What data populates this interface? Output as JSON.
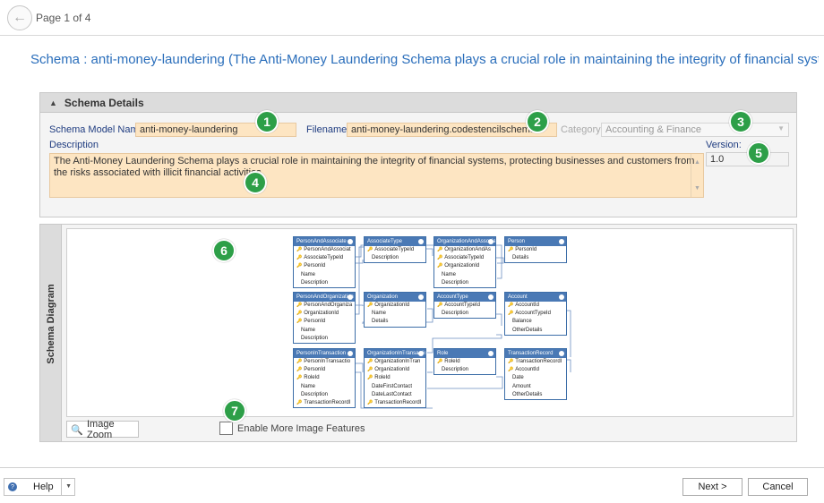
{
  "header": {
    "back_icon": "back-arrow-icon",
    "page_indicator": "Page 1 of 4"
  },
  "schema_title": "Schema : anti-money-laundering (The Anti-Money Laundering Schema plays a crucial role in maintaining the integrity of financial systen",
  "details": {
    "header": "Schema Details",
    "schema_model_name_label": "Schema Model Name:",
    "schema_model_name_value": "anti-money-laundering",
    "filename_label": "Filename:",
    "filename_value": "anti-money-laundering.codestencilschema",
    "category_label": "Category:",
    "category_value": "Accounting & Finance",
    "description_label": "Description",
    "description_value": "The Anti-Money Laundering Schema plays a crucial role in maintaining the integrity of financial systems, protecting businesses and customers from the risks associated with illicit financial activities.",
    "version_label": "Version:",
    "version_value": "1.0"
  },
  "badges": [
    "1",
    "2",
    "3",
    "4",
    "5",
    "6",
    "7"
  ],
  "diagram": {
    "side_label": "Schema Diagram",
    "tables": [
      {
        "name": "PersonAndAssociate",
        "rows": [
          {
            "t": "PersonAndAssociat",
            "k": true
          },
          {
            "t": "AssociateTypeId",
            "k": true
          },
          {
            "t": "PersonId",
            "k": true
          },
          {
            "t": "Name",
            "k": false
          },
          {
            "t": "Description",
            "k": false
          }
        ]
      },
      {
        "name": "AssociateType",
        "rows": [
          {
            "t": "AssociateTypeId",
            "k": true
          },
          {
            "t": "Description",
            "k": false
          }
        ]
      },
      {
        "name": "OrganizationAndAssociate",
        "rows": [
          {
            "t": "OrganizationAndAs",
            "k": true
          },
          {
            "t": "AssociateTypeId",
            "k": true
          },
          {
            "t": "OrganizationId",
            "k": true
          },
          {
            "t": "Name",
            "k": false
          },
          {
            "t": "Description",
            "k": false
          }
        ]
      },
      {
        "name": "Person",
        "rows": [
          {
            "t": "PersonId",
            "k": true
          },
          {
            "t": "Details",
            "k": false
          }
        ]
      },
      {
        "name": "PersonAndOrganization",
        "rows": [
          {
            "t": "PersonAndOrganiza",
            "k": true
          },
          {
            "t": "OrganizationId",
            "k": true
          },
          {
            "t": "PersonId",
            "k": true
          },
          {
            "t": "Name",
            "k": false
          },
          {
            "t": "Description",
            "k": false
          }
        ]
      },
      {
        "name": "Organization",
        "rows": [
          {
            "t": "OrganizationId",
            "k": true
          },
          {
            "t": "Name",
            "k": false
          },
          {
            "t": "Details",
            "k": false
          }
        ]
      },
      {
        "name": "AccountType",
        "rows": [
          {
            "t": "AccountTypeId",
            "k": true
          },
          {
            "t": "Description",
            "k": false
          }
        ]
      },
      {
        "name": "Account",
        "rows": [
          {
            "t": "AccountId",
            "k": true
          },
          {
            "t": "AccountTypeId",
            "k": true
          },
          {
            "t": "Balance",
            "k": false
          },
          {
            "t": "OtherDetails",
            "k": false
          }
        ]
      },
      {
        "name": "PersonInTransaction",
        "rows": [
          {
            "t": "PersonInTransactio",
            "k": true
          },
          {
            "t": "PersonId",
            "k": true
          },
          {
            "t": "RoleId",
            "k": true
          },
          {
            "t": "Name",
            "k": false
          },
          {
            "t": "Description",
            "k": false
          },
          {
            "t": "TransactionRecordI",
            "k": true
          }
        ]
      },
      {
        "name": "OrganizationInTransaction",
        "rows": [
          {
            "t": "OrganizationInTran",
            "k": true
          },
          {
            "t": "OrganizationId",
            "k": true
          },
          {
            "t": "RoleId",
            "k": true
          },
          {
            "t": "DateFirstContact",
            "k": false
          },
          {
            "t": "DateLastContact",
            "k": false
          },
          {
            "t": "TransactionRecordI",
            "k": true
          }
        ]
      },
      {
        "name": "Role",
        "rows": [
          {
            "t": "RoleId",
            "k": true
          },
          {
            "t": "Description",
            "k": false
          }
        ]
      },
      {
        "name": "TransactionRecord",
        "rows": [
          {
            "t": "TransactionRecordI",
            "k": true
          },
          {
            "t": "AccountId",
            "k": true
          },
          {
            "t": "Date",
            "k": false
          },
          {
            "t": "Amount",
            "k": false
          },
          {
            "t": "OtherDetails",
            "k": false
          }
        ]
      }
    ],
    "image_zoom_label": "Image Zoom",
    "enable_features_label": "Enable More Image Features"
  },
  "footer": {
    "help_label": "Help",
    "next_label": "Next >",
    "cancel_label": "Cancel"
  }
}
